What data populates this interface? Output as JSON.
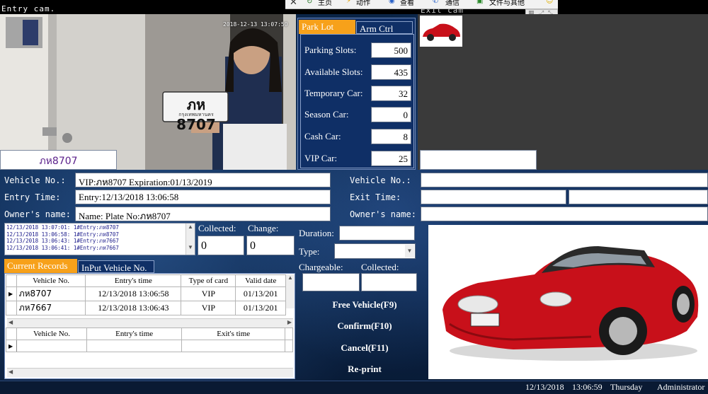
{
  "top_bar": {
    "entry_cam_label": "Entry cam.",
    "exit_cam_label": "Exit cam",
    "browser_items": [
      "主页",
      "动作",
      "查看",
      "通信",
      "文件与其他"
    ]
  },
  "entry_cam": {
    "timestamp": "2018-12-13 13:07:50",
    "plate_display": "ภห 8707",
    "plate_province": "กรุงเทพมหานคร",
    "plate_result": "ภห8707"
  },
  "parking_panel": {
    "tabs": [
      "Park Lot",
      "Arm Ctrl"
    ],
    "rows": [
      {
        "label": "Parking Slots:",
        "value": "500"
      },
      {
        "label": "Available Slots:",
        "value": "435"
      },
      {
        "label": "Temporary Car:",
        "value": "32"
      },
      {
        "label": "Season Car:",
        "value": "0"
      },
      {
        "label": "Cash Car:",
        "value": "8"
      },
      {
        "label": "VIP Car:",
        "value": "25"
      }
    ]
  },
  "entry_info": {
    "vehicle_label": "Vehicle No.:",
    "vehicle_value": "VIP:ภห8707 Expiration:01/13/2019",
    "entry_time_label": "Entry Time:",
    "entry_time_value": "Entry:12/13/2018 13:06:58",
    "owner_label": "Owner's name:",
    "owner_value": "Name:  Plate No:ภห8707"
  },
  "exit_info": {
    "vehicle_label": "Vehicle No.:",
    "exit_time_label": "Exit Time:",
    "owner_label": "Owner's name:"
  },
  "log": {
    "lines": [
      "12/13/2018 13:07:01: 1#Entry:ภห8707",
      "12/13/2018 13:06:58: 1#Entry:ภห8707",
      "12/13/2018 13:06:43: 1#Entry:ภห7667",
      "12/13/2018 13:06:41: 1#Entry:ภห7667"
    ]
  },
  "collect": {
    "collected_label": "Collected:",
    "change_label": "Change:",
    "collected_value": "0",
    "change_value": "0"
  },
  "records": {
    "tabs": [
      "Current Records",
      "InPut Vehicle No."
    ],
    "columns": [
      "Vehicle No.",
      "Entry's time",
      "Type of card",
      "Valid date"
    ],
    "rows": [
      {
        "vehicle": "ภห8707",
        "entry": "12/13/2018 13:06:58",
        "type": "VIP",
        "valid": "01/13/201"
      },
      {
        "vehicle": "ภห7667",
        "entry": "12/13/2018 13:06:43",
        "type": "VIP",
        "valid": "01/13/201"
      }
    ],
    "bottom_columns": [
      "Vehicle No.",
      "Entry's time",
      "Exit's time"
    ]
  },
  "payment": {
    "duration_label": "Duration:",
    "type_label": "Type:",
    "chargeable_label": "Chargeable:",
    "collected_label": "Collected:"
  },
  "buttons": {
    "free": "Free Vehicle(F9)",
    "confirm": "Confirm(F10)",
    "cancel": "Cancel(F11)",
    "reprint": "Re-print"
  },
  "status_bar": {
    "date": "12/13/2018",
    "time": "13:06:59",
    "weekday": "Thursday",
    "user": "Administrator"
  },
  "colors": {
    "accent_orange": "#f7a11a",
    "panel_navy": "#0f2f66",
    "background": "#0b1f3a",
    "car_red": "#c8101a"
  }
}
